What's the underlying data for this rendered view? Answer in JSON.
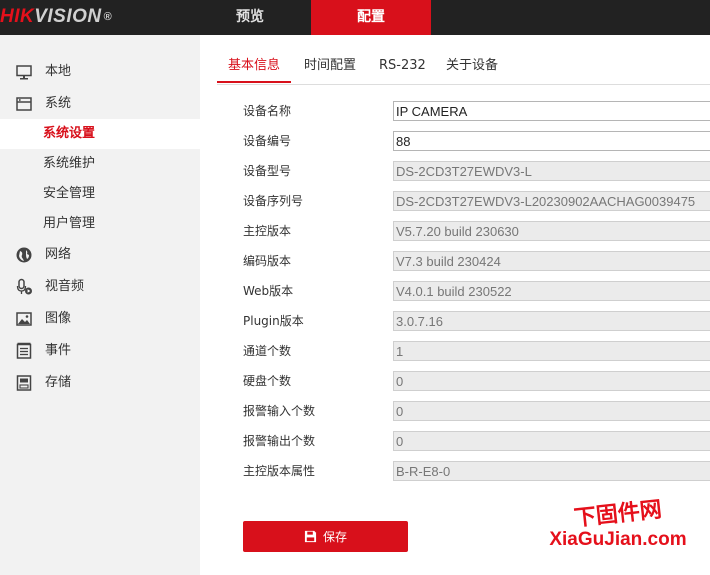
{
  "header": {
    "brand_red": "HIK",
    "brand_rest": "VISION",
    "brand_reg": "®",
    "nav": {
      "preview": "预览",
      "config": "配置"
    }
  },
  "sidebar": {
    "local": "本地",
    "system": "系统",
    "system_settings": "系统设置",
    "maintenance": "系统维护",
    "security": "安全管理",
    "users": "用户管理",
    "network": "网络",
    "video_audio": "视音频",
    "image": "图像",
    "event": "事件",
    "storage": "存储"
  },
  "tabs": {
    "basic": "基本信息",
    "time": "时间配置",
    "rs232": "RS-232",
    "about": "关于设备"
  },
  "form": {
    "rows": [
      {
        "label": "设备名称",
        "value": "IP CAMERA",
        "readonly": false
      },
      {
        "label": "设备编号",
        "value": "88",
        "readonly": false
      },
      {
        "label": "设备型号",
        "value": "DS-2CD3T27EWDV3-L",
        "readonly": true
      },
      {
        "label": "设备序列号",
        "value": "DS-2CD3T27EWDV3-L20230902AACHAG0039475",
        "readonly": true
      },
      {
        "label": "主控版本",
        "value": "V5.7.20 build 230630",
        "readonly": true
      },
      {
        "label": "编码版本",
        "value": "V7.3 build 230424",
        "readonly": true
      },
      {
        "label": "Web版本",
        "value": "V4.0.1 build 230522",
        "readonly": true
      },
      {
        "label": "Plugin版本",
        "value": "3.0.7.16",
        "readonly": true
      },
      {
        "label": "通道个数",
        "value": "1",
        "readonly": true
      },
      {
        "label": "硬盘个数",
        "value": "0",
        "readonly": true
      },
      {
        "label": "报警输入个数",
        "value": "0",
        "readonly": true
      },
      {
        "label": "报警输出个数",
        "value": "0",
        "readonly": true
      },
      {
        "label": "主控版本属性",
        "value": "B-R-E8-0",
        "readonly": true
      }
    ],
    "save_label": "保存"
  },
  "watermark": {
    "cn": "下固件网",
    "en": "XiaGuJian.com"
  },
  "colors": {
    "accent": "#d8101b",
    "topbar": "#222222",
    "sidebar_bg": "#f2f2f2",
    "readonly_bg": "#ebebeb"
  },
  "icons": {
    "local": "monitor-icon",
    "system": "system-icon",
    "network": "globe-icon",
    "video_audio": "microphone-icon",
    "image": "picture-icon",
    "event": "list-icon",
    "storage": "disk-icon",
    "save": "floppy-icon"
  }
}
